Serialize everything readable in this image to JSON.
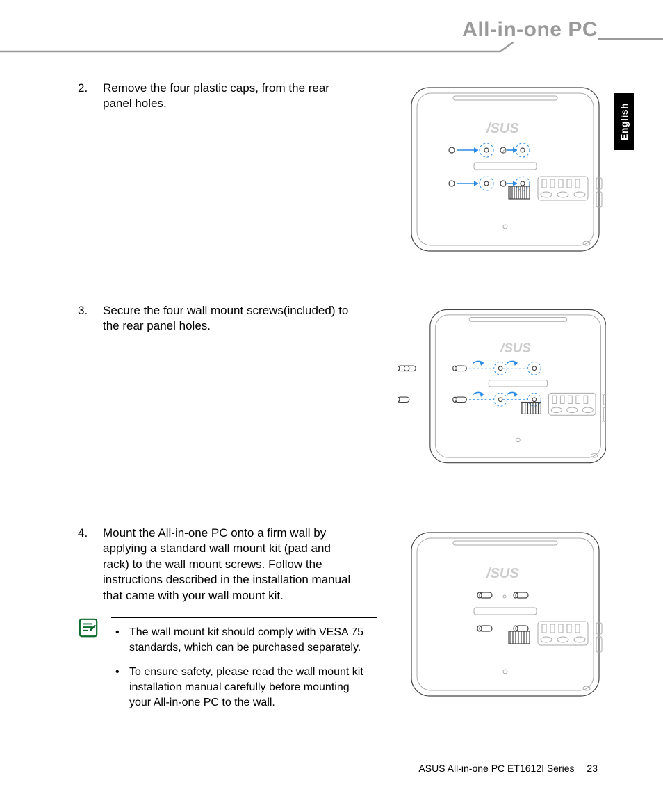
{
  "header": {
    "title": "All-in-one PC"
  },
  "language_tab": "English",
  "steps": [
    {
      "num": "2.",
      "text": "Remove the four plastic caps, from the rear panel holes."
    },
    {
      "num": "3.",
      "text": "Secure the four wall mount screws(included) to the rear panel holes."
    },
    {
      "num": "4.",
      "text": "Mount the All-in-one PC onto a firm wall by applying a standard wall mount kit (pad and rack) to the wall mount screws. Follow the instructions described in the installation manual that came with your wall mount kit."
    }
  ],
  "notes": [
    "The wall mount kit should comply with VESA 75 standards, which can be purchased separately.",
    "To ensure safety, please read the wall mount kit installation manual carefully before mounting your All-in-one PC to the wall."
  ],
  "footer": {
    "product": "ASUS All-in-one PC  ET1612I Series",
    "page": "23"
  },
  "illustration_logo": "/SUS"
}
